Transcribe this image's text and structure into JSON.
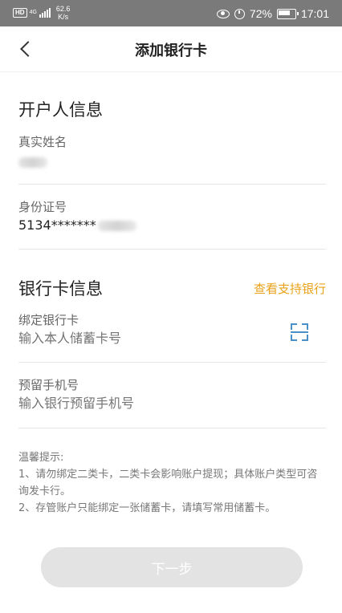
{
  "status_bar": {
    "hd": "HD",
    "network": "4G",
    "net_speed_value": "62.6",
    "net_speed_unit": "K/s",
    "battery": "72%",
    "time": "17:01"
  },
  "nav": {
    "title": "添加银行卡"
  },
  "account_info": {
    "section_title": "开户人信息",
    "name_label": "真实姓名",
    "id_label": "身份证号",
    "id_value": "5134*******"
  },
  "bank_info": {
    "section_title": "银行卡信息",
    "support_link": "查看支持银行",
    "card_label": "绑定银行卡",
    "card_placeholder": "输入本人储蓄卡号",
    "phone_label": "预留手机号",
    "phone_placeholder": "输入银行预留手机号"
  },
  "tips": {
    "title": "温馨提示:",
    "line1": "1、请勿绑定二类卡，二类卡会影响账户提现；具体账户类型可咨询发卡行。",
    "line2": "2、存管账户只能绑定一张储蓄卡，请填写常用储蓄卡。"
  },
  "next_button": "下一步"
}
